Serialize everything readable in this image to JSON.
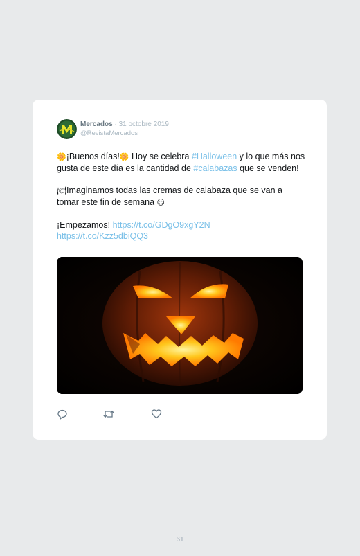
{
  "tweet": {
    "author_name": "Mercados",
    "separator": "·",
    "date": "31 octobre 2019",
    "handle": "@RevistaMercados",
    "p1": {
      "pre_emoji": "🌼",
      "text_a": "¡Buenos días!",
      "mid_emoji": "🌼",
      "text_b": " Hoy se celebra ",
      "hashtag1": "#Halloween",
      "text_c": " y lo que más nos gusta de este día es la cantidad de ",
      "hashtag2": "#calabazas",
      "text_d": " que se venden!"
    },
    "p2": {
      "emoji": "🍽",
      "text": "Imaginamos todas las cremas de calabaza que se van a tomar este fin de semana ",
      "end_emoji": "☺"
    },
    "p3": {
      "text": "¡Empezamos! ",
      "link1": "https://t.co/GDgO9xgY2N",
      "link2": "https://t.co/Kzz5dbiQQ3"
    }
  },
  "colors": {
    "link": "#7ac0e8",
    "muted": "#aab8c2",
    "name": "#66757f",
    "card": "#ffffff",
    "background": "#e8eaeb"
  },
  "actions": {
    "reply_icon": "reply-icon",
    "retweet_icon": "retweet-icon",
    "like_icon": "heart-icon"
  },
  "page_number": "61"
}
